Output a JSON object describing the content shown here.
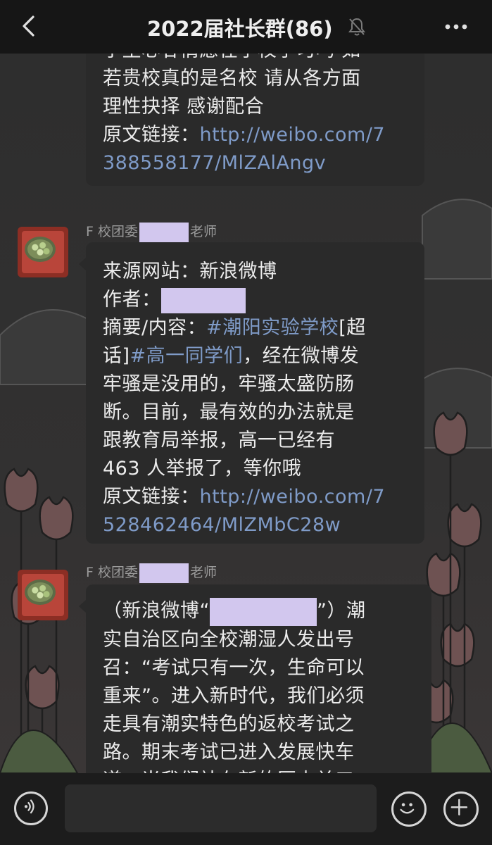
{
  "header": {
    "title": "2022届社长群(86)",
    "back_icon": "chevron-left-icon",
    "mute_icon": "bell-slash-icon",
    "more_icon": "more-dots-icon"
  },
  "messages": [
    {
      "lines": [
        "学生心甘情愿在学校学习吗 如",
        "若贵校真的是名校 请从各方面",
        "理性抉择 感谢配合"
      ],
      "link_label": "原文链接：",
      "link_line1": "http://weibo.com/7",
      "link_line2": "388558177/MlZAlAngv"
    },
    {
      "sender_prefix": "F 校团委",
      "sender_suffix": "老师",
      "source_label": "来源网站：新浪微博",
      "author_label": "作者：",
      "summary_label": "摘要/内容：",
      "summary_tag1": "#潮阳实验学校",
      "summary_rest1": "[超",
      "line2_a": "话]",
      "line2_tag": "#高一同学们",
      "line2_b": "，经在微博发",
      "lines": [
        "牢骚是没用的，牢骚太盛防肠",
        "断。目前，最有效的办法就是",
        "跟教育局举报，高一已经有",
        "463 人举报了，等你哦"
      ],
      "link_label": "原文链接：",
      "link_line1": "http://weibo.com/7",
      "link_line2": "528462464/MlZMbC28w"
    },
    {
      "sender_prefix": "F 校团委",
      "sender_suffix": "老师",
      "first_a": "（新浪微博“",
      "first_b": "”）潮",
      "lines": [
        "实自治区向全校潮湿人发出号",
        "召：“考试只有一次，生命可以",
        "重来”。进入新时代，我们必须",
        "走具有潮实特色的返校考试之",
        "路。期末考试已进入发展快车",
        "道，当我们站在新的历史关口"
      ]
    }
  ],
  "bottom": {
    "voice_icon": "voice-icon",
    "emoji_icon": "emoji-icon",
    "plus_icon": "plus-icon"
  },
  "colors": {
    "link": "#7f9bc8",
    "redaction": "#d2c7ee",
    "bubble": "#2a2a2a"
  }
}
